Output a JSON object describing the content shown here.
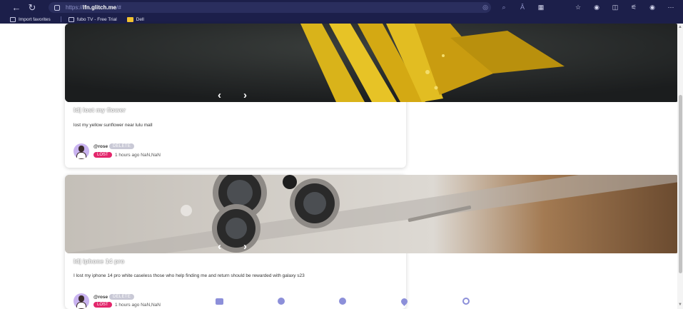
{
  "browser": {
    "url_protocol": "https://",
    "url_host": "lfn.glitch.me",
    "url_hash": "/#",
    "bookmarks": [
      {
        "label": "Import favorites"
      },
      {
        "label": "fubo TV - Free Trial"
      },
      {
        "label": "Dell"
      }
    ]
  },
  "posts": [
    {
      "title": "Iđ| lost my flower",
      "description": "lost my yellow sunflower near lulu mall",
      "username": "@rose",
      "delete_label": "DELETE",
      "status": "LOST",
      "time": "1 hours ago NaN,NaN"
    },
    {
      "title": "Iđ| iphone 14 pro",
      "description": "I lost my iphone 14 pro white caseless those who help finding me and return should be rewarded with galaxy s23",
      "username": "@rose",
      "delete_label": "DELETE",
      "status": "LOST",
      "time": "1 hours ago NaN,NaN"
    }
  ],
  "colors": {
    "lost_badge": "#e3266b",
    "nav_accent": "#8c8fd9",
    "chrome": "#1c1f4a"
  }
}
